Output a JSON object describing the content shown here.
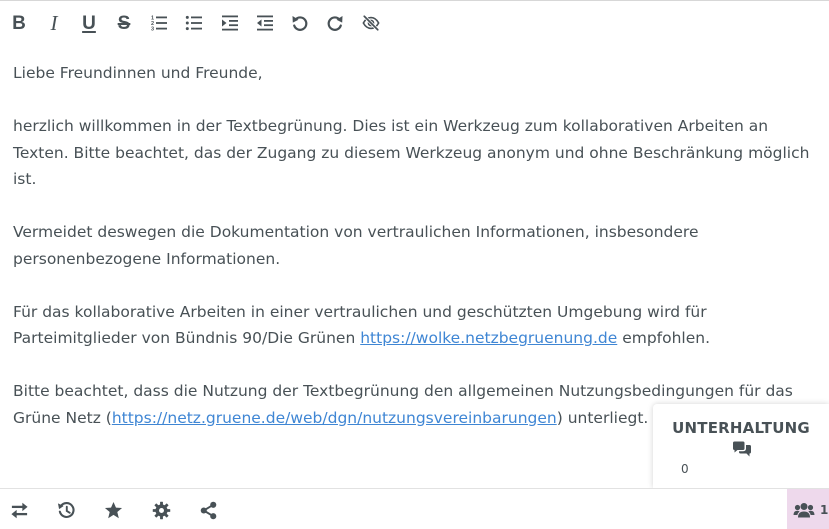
{
  "toolbar": {
    "bold": "B",
    "italic": "I",
    "underline": "U",
    "strike": "S"
  },
  "document": {
    "greeting": "Liebe Freundinnen und Freunde,",
    "p1": "herzlich willkommen in der Textbegrünung. Dies ist ein Werkzeug zum kollaborativen Arbeiten an Texten. Bitte beachtet, das der Zugang zu diesem Werkzeug anonym und ohne Beschränkung möglich ist.",
    "p2": "Vermeidet deswegen die Dokumentation von vertraulichen Informationen, insbesondere personenbezogene Informationen.",
    "p3_before": "Für das kollaborative Arbeiten in einer vertraulichen und geschützten Umgebung wird für Parteimitglieder von Bündnis 90/Die Grünen ",
    "p3_link": "https://wolke.netzbegruenung.de",
    "p3_after": " empfohlen.",
    "p4_before": "Bitte beachtet, dass die Nutzung der Textbegrünung den allgemeinen Nutzungsbedingungen für das Grüne Netz (",
    "p4_link": "https://netz.gruene.de/web/dgn/nutzungsvereinbarungen",
    "p4_after": ") unterliegt."
  },
  "conversation": {
    "title": "UNTERHALTUNG",
    "count": "0"
  },
  "users": {
    "count": "1"
  },
  "colors": {
    "text": "#485156",
    "link": "#3f86d4",
    "users_bg": "#eed9ec"
  }
}
